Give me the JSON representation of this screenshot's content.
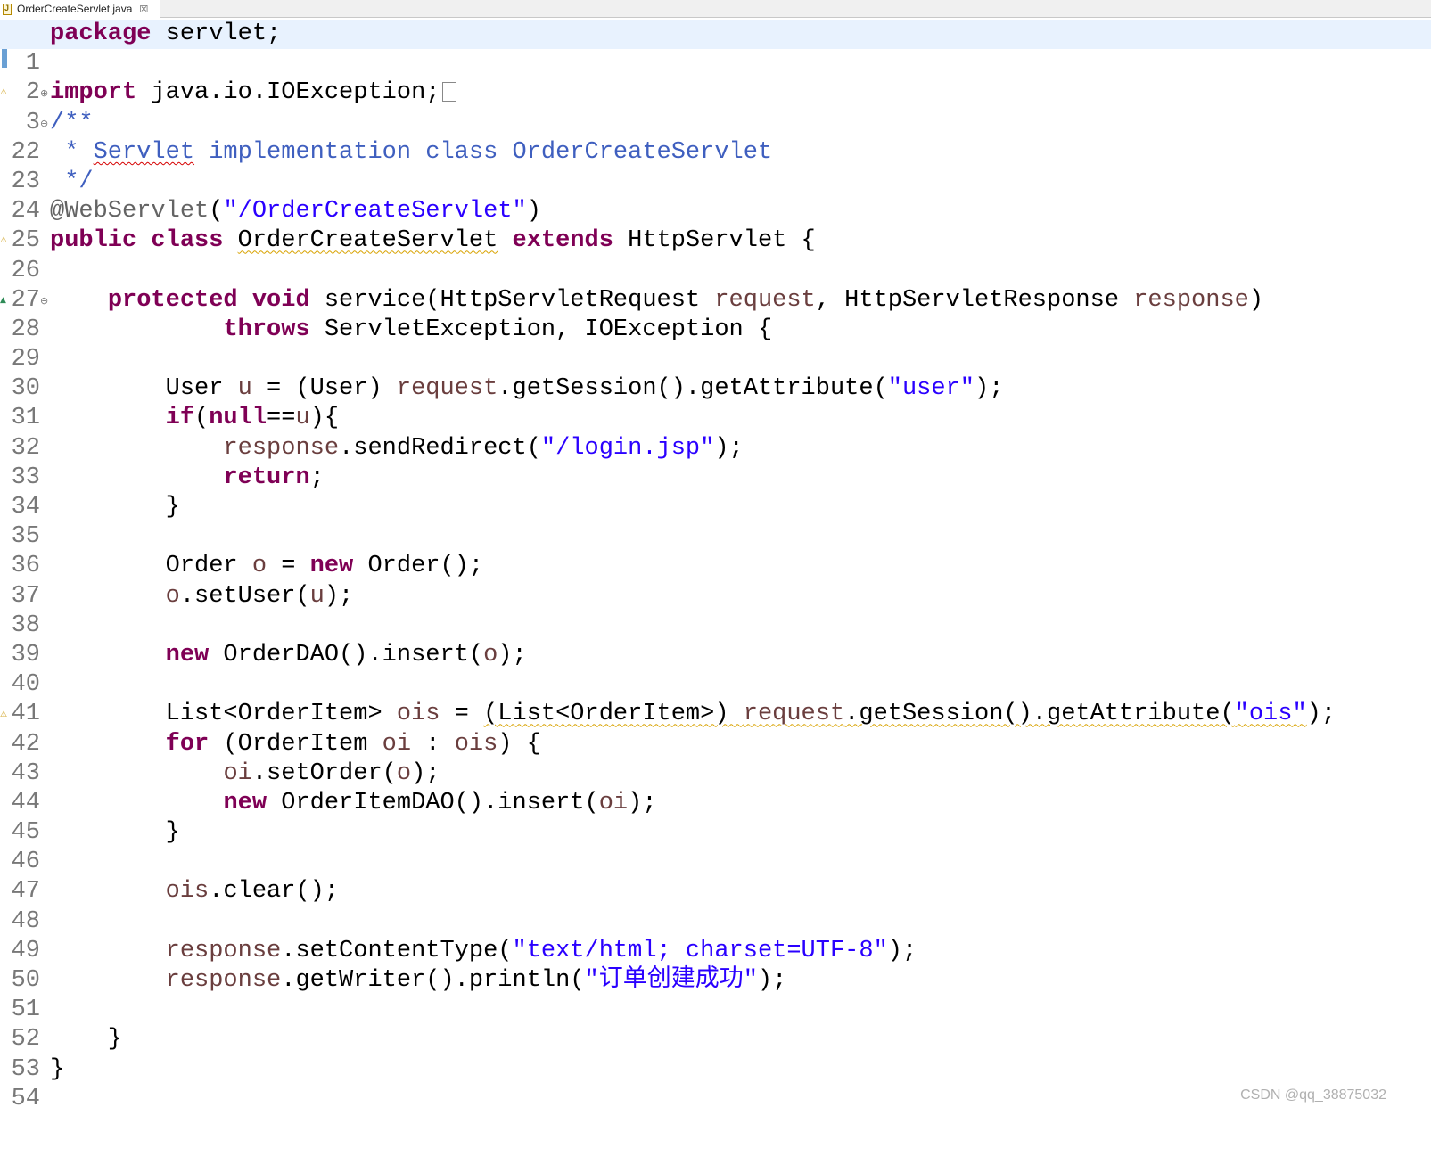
{
  "tab": {
    "file_name": "OrderCreateServlet.java",
    "close_symbol": "☒"
  },
  "markers": {
    "warning": "⚠",
    "override": "▲"
  },
  "watermark": "CSDN @qq_38875032",
  "code": {
    "l1": {
      "n": "1",
      "a": "package",
      "b": " servlet;"
    },
    "l2": {
      "n": "2"
    },
    "l3": {
      "n": "3",
      "a": "import",
      "b": " java.io.IOException;"
    },
    "l22": {
      "n": "22",
      "a": "/**"
    },
    "l23": {
      "n": "23",
      "a": " * ",
      "b": "Servlet",
      "c": " implementation class OrderCreateServlet"
    },
    "l24": {
      "n": "24",
      "a": " */"
    },
    "l25": {
      "n": "25",
      "a": "@WebServlet",
      "b": "(",
      "c": "\"/OrderCreateServlet\"",
      "d": ")"
    },
    "l26": {
      "n": "26",
      "a": "public",
      "b": " ",
      "c": "class",
      "d": " ",
      "e": "OrderCreateServlet",
      "f": " ",
      "g": "extends",
      "h": " HttpServlet {"
    },
    "l27": {
      "n": "27"
    },
    "l28": {
      "n": "28",
      "a": "    ",
      "b": "protected",
      "c": " ",
      "d": "void",
      "e": " service(HttpServletRequest ",
      "f": "request",
      "g": ", HttpServletResponse ",
      "h": "response",
      "i": ")"
    },
    "l29": {
      "n": "29",
      "a": "            ",
      "b": "throws",
      "c": " ServletException, IOException {"
    },
    "l30": {
      "n": "30"
    },
    "l31": {
      "n": "31",
      "a": "        User ",
      "b": "u",
      "c": " = (User) ",
      "d": "request",
      "e": ".getSession().getAttribute(",
      "f": "\"user\"",
      "g": ");"
    },
    "l32": {
      "n": "32",
      "a": "        ",
      "b": "if",
      "c": "(",
      "d": "null",
      "e": "==",
      "f": "u",
      "g": "){"
    },
    "l33": {
      "n": "33",
      "a": "            ",
      "b": "response",
      "c": ".sendRedirect(",
      "d": "\"/login.jsp\"",
      "e": ");"
    },
    "l34": {
      "n": "34",
      "a": "            ",
      "b": "return",
      "c": ";"
    },
    "l35": {
      "n": "35",
      "a": "        }"
    },
    "l36": {
      "n": "36"
    },
    "l37": {
      "n": "37",
      "a": "        Order ",
      "b": "o",
      "c": " = ",
      "d": "new",
      "e": " Order();"
    },
    "l38": {
      "n": "38",
      "a": "        ",
      "b": "o",
      "c": ".setUser(",
      "d": "u",
      "e": ");"
    },
    "l39": {
      "n": "39"
    },
    "l40": {
      "n": "40",
      "a": "        ",
      "b": "new",
      "c": " OrderDAO().insert(",
      "d": "o",
      "e": ");"
    },
    "l41": {
      "n": "41"
    },
    "l42": {
      "n": "42",
      "a": "        List<OrderItem> ",
      "b": "ois",
      "c": " = ",
      "d": "(List<OrderItem>) ",
      "e": "request",
      "f": ".getSession().getAttribute(",
      "g": "\"ois\"",
      "h": ");"
    },
    "l43": {
      "n": "43",
      "a": "        ",
      "b": "for",
      "c": " (OrderItem ",
      "d": "oi",
      "e": " : ",
      "f": "ois",
      "g": ") {"
    },
    "l44": {
      "n": "44",
      "a": "            ",
      "b": "oi",
      "c": ".setOrder(",
      "d": "o",
      "e": ");"
    },
    "l45": {
      "n": "45",
      "a": "            ",
      "b": "new",
      "c": " OrderItemDAO().insert(",
      "d": "oi",
      "e": ");"
    },
    "l46": {
      "n": "46",
      "a": "        }"
    },
    "l47": {
      "n": "47"
    },
    "l48": {
      "n": "48",
      "a": "        ",
      "b": "ois",
      "c": ".clear();"
    },
    "l49": {
      "n": "49"
    },
    "l50": {
      "n": "50",
      "a": "        ",
      "b": "response",
      "c": ".setContentType(",
      "d": "\"text/html; charset=UTF-8\"",
      "e": ");"
    },
    "l51": {
      "n": "51",
      "a": "        ",
      "b": "response",
      "c": ".getWriter().println(",
      "d": "\"订单创建成功\"",
      "e": ");"
    },
    "l52": {
      "n": "52"
    },
    "l53": {
      "n": "53",
      "a": "    }"
    },
    "l54": {
      "n": "54",
      "a": "}"
    }
  }
}
